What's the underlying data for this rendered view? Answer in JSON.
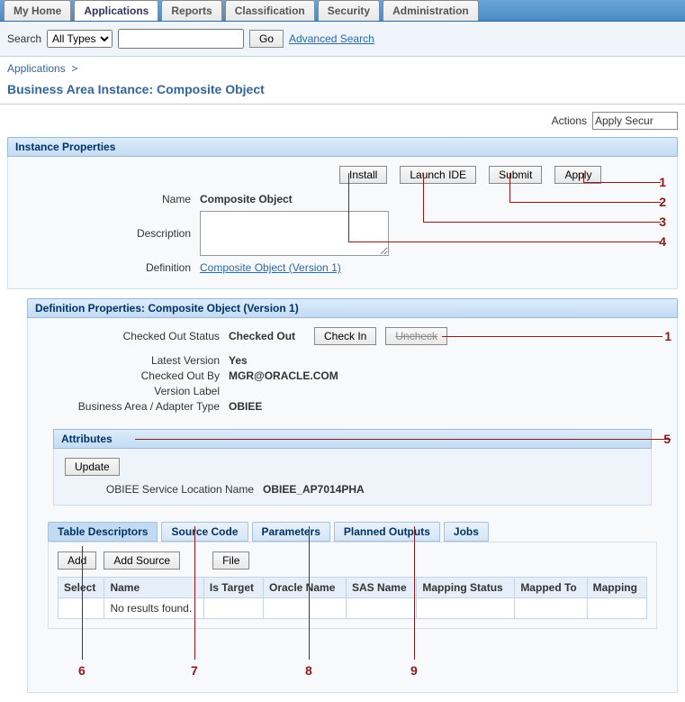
{
  "topTabs": [
    "My Home",
    "Applications",
    "Reports",
    "Classification",
    "Security",
    "Administration"
  ],
  "topActive": 1,
  "search": {
    "label": "Search",
    "selectValue": "All Types",
    "go": "Go",
    "advanced": "Advanced Search"
  },
  "breadcrumb": {
    "item": "Applications",
    "sep": ">"
  },
  "pageTitle": "Business Area Instance: Composite Object",
  "actions": {
    "label": "Actions",
    "selected": "Apply Secur"
  },
  "instanceProps": {
    "header": "Instance Properties",
    "buttons": {
      "install": "Install",
      "launchIde": "Launch IDE",
      "submit": "Submit",
      "apply": "Apply"
    },
    "nameLabel": "Name",
    "nameValue": "Composite Object",
    "descLabel": "Description",
    "descValue": "",
    "defLabel": "Definition",
    "defLink": "Composite Object (Version 1)",
    "callouts": [
      "1",
      "2",
      "3",
      "4"
    ]
  },
  "defProps": {
    "header": "Definition Properties: Composite Object (Version 1)",
    "checkedOutStatusLabel": "Checked Out Status",
    "checkedOutStatusValue": "Checked Out",
    "checkIn": "Check In",
    "uncheck": "Uncheck",
    "latestVersionLabel": "Latest Version",
    "latestVersionValue": "Yes",
    "checkedOutByLabel": "Checked Out By",
    "checkedOutByValue": "MGR@ORACLE.COM",
    "versionLabelLabel": "Version Label",
    "versionLabelValue": "",
    "businessAreaLabel": "Business Area / Adapter Type",
    "businessAreaValue": "OBIEE",
    "callout": "1"
  },
  "attributes": {
    "header": "Attributes",
    "update": "Update",
    "serviceLocLabel": "OBIEE Service Location Name",
    "serviceLocValue": "OBIEE_AP7014PHA",
    "callout": "5"
  },
  "lowerTabs": [
    "Table Descriptors",
    "Source Code",
    "Parameters",
    "Planned Outputs",
    "Jobs"
  ],
  "lowerActive": 0,
  "lowerSection": {
    "add": "Add",
    "addSource": "Add Source",
    "file": "File",
    "columns": [
      "Select",
      "Name",
      "Is Target",
      "Oracle Name",
      "SAS Name",
      "Mapping Status",
      "Mapped To",
      "Mapping"
    ],
    "noResults": "No results found."
  },
  "bottomCallouts": [
    "6",
    "7",
    "8",
    "9"
  ]
}
